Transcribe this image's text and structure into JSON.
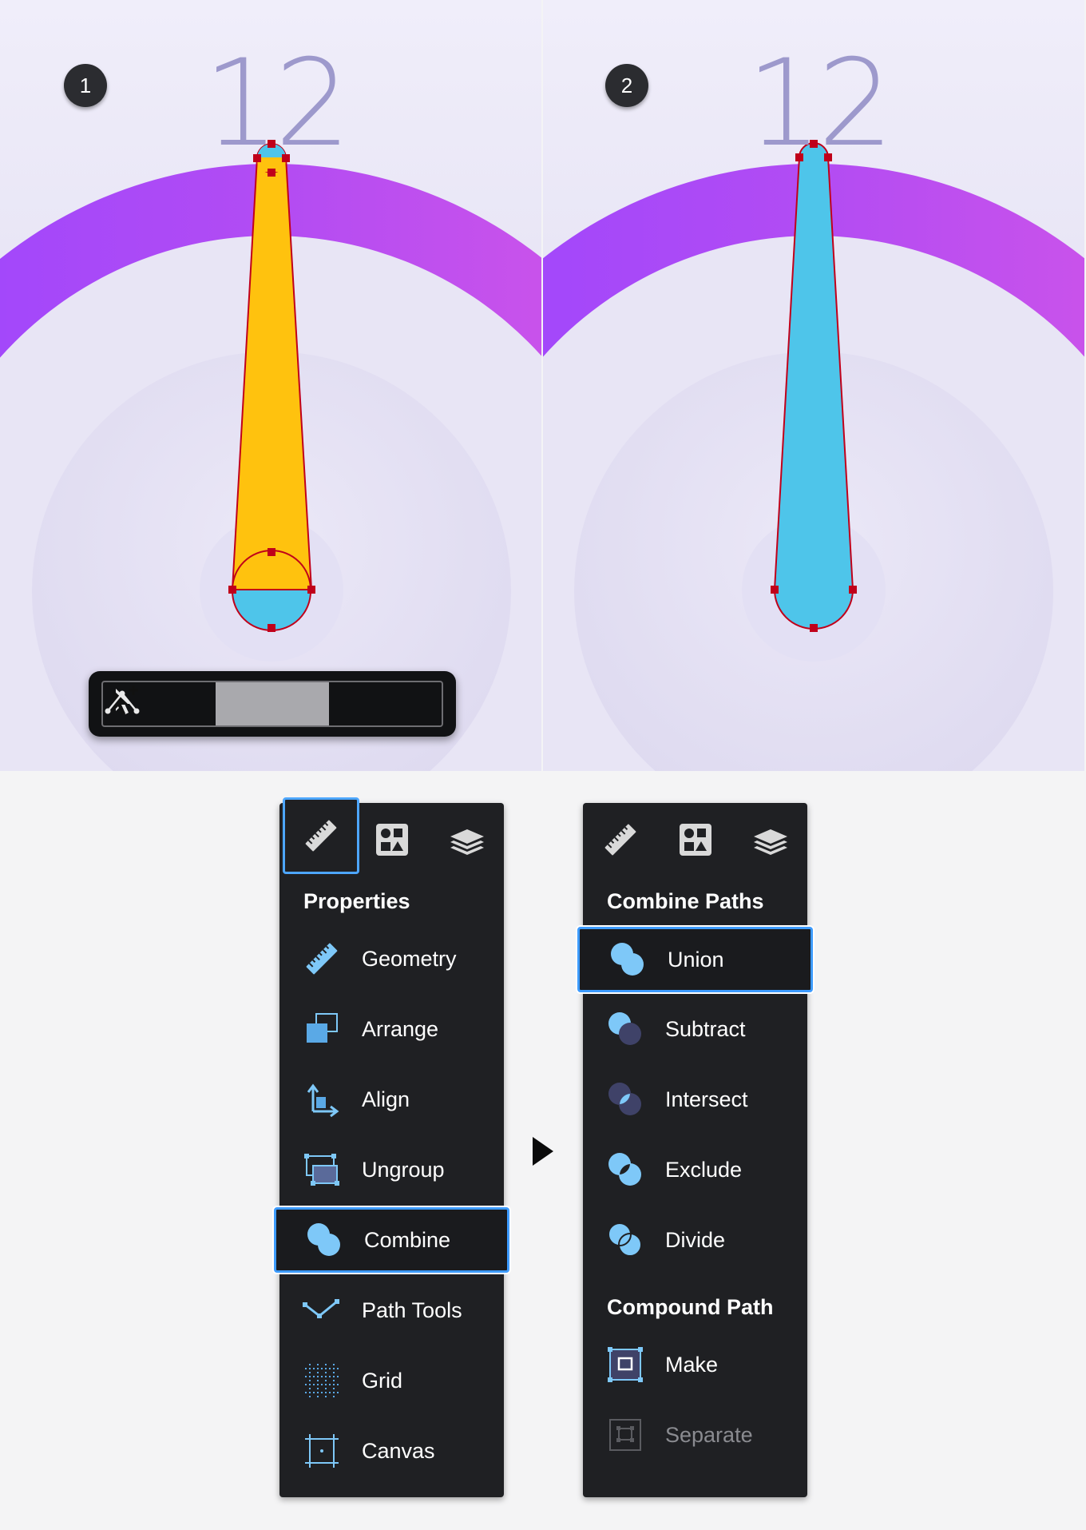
{
  "steps": [
    {
      "badge": "1",
      "clock_number": "12"
    },
    {
      "badge": "2",
      "clock_number": "12"
    }
  ],
  "toolbar": {
    "tools": [
      {
        "icon": "arrow-pointer-icon",
        "active": false
      },
      {
        "icon": "arrow-pointer-plus-icon",
        "active": true
      },
      {
        "icon": "node-path-icon",
        "active": false
      }
    ]
  },
  "properties_panel": {
    "tabs": [
      {
        "icon": "ruler-icon",
        "selected": true
      },
      {
        "icon": "shapes-icon",
        "selected": false
      },
      {
        "icon": "layers-icon",
        "selected": false
      }
    ],
    "heading": "Properties",
    "items": [
      {
        "label": "Geometry",
        "icon": "ruler-icon"
      },
      {
        "label": "Arrange",
        "icon": "arrange-icon"
      },
      {
        "label": "Align",
        "icon": "align-icon"
      },
      {
        "label": "Ungroup",
        "icon": "ungroup-icon"
      },
      {
        "label": "Combine",
        "icon": "combine-icon",
        "highlighted": true
      },
      {
        "label": "Path Tools",
        "icon": "path-tools-icon"
      },
      {
        "label": "Grid",
        "icon": "grid-icon"
      },
      {
        "label": "Canvas",
        "icon": "canvas-icon"
      }
    ]
  },
  "combine_panel": {
    "heading": "Combine Paths",
    "items": [
      {
        "label": "Union",
        "icon": "union-icon",
        "highlighted": true
      },
      {
        "label": "Subtract",
        "icon": "subtract-icon"
      },
      {
        "label": "Intersect",
        "icon": "intersect-icon"
      },
      {
        "label": "Exclude",
        "icon": "exclude-icon"
      },
      {
        "label": "Divide",
        "icon": "divide-icon"
      }
    ],
    "subheading": "Compound Path",
    "compound_items": [
      {
        "label": "Make",
        "icon": "make-compound-icon"
      },
      {
        "label": "Separate",
        "icon": "separate-compound-icon",
        "disabled": true
      }
    ]
  },
  "colors": {
    "hand_yellow": "#ffc20e",
    "hand_blue": "#4ec5ea",
    "anchor_red": "#c0001a",
    "arc_start": "#9b3dff",
    "arc_end": "#d44ee6",
    "panel_bg": "#1f2023",
    "highlight_blue": "#3d9bff"
  }
}
